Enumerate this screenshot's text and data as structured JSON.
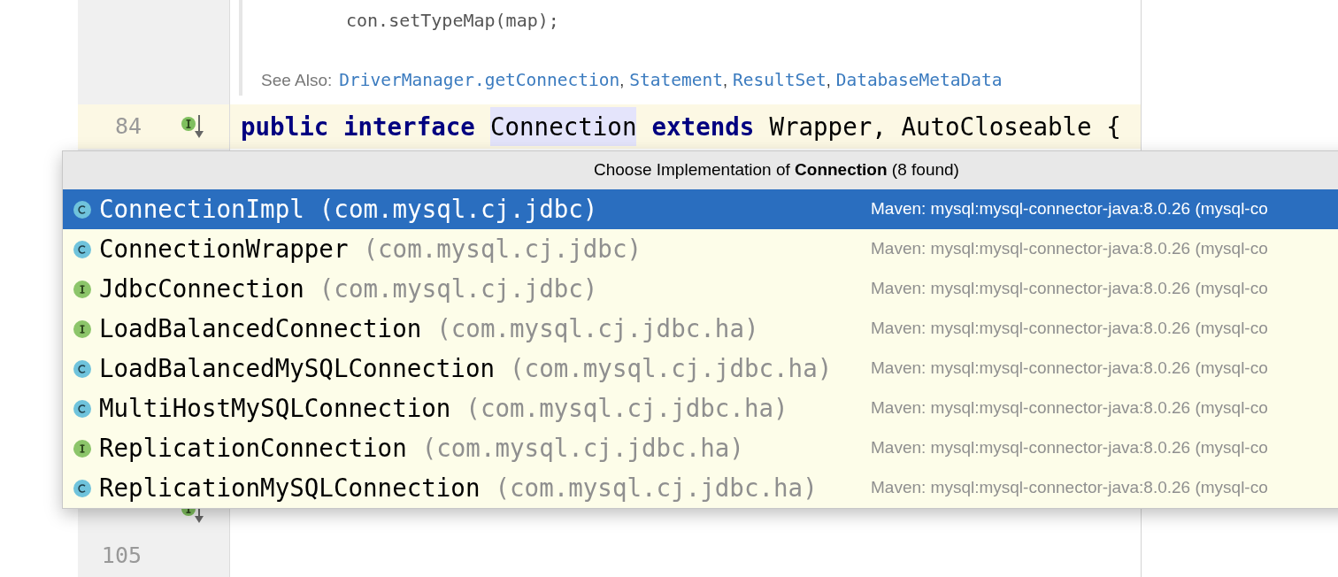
{
  "editor": {
    "doc": {
      "code_line": "con.setTypeMap(map);",
      "see_also_label": "See Also:",
      "separator": ",",
      "see_also_links": [
        "DriverManager.getConnection",
        "Statement",
        "ResultSet",
        "DatabaseMetaData"
      ]
    },
    "lines_top": [
      {
        "number": "84",
        "implementation_marker": true,
        "current": true,
        "tokens": [
          {
            "text": "public interface",
            "kind": "keyword"
          },
          {
            "text": "Connection",
            "kind": "highlighted"
          },
          {
            "text": "extends",
            "kind": "keyword"
          },
          {
            "text": "Wrapper, AutoCloseable {",
            "kind": "plain"
          }
        ]
      }
    ],
    "lines_bottom": [
      {
        "implementation_marker": true,
        "current": false
      },
      {
        "number": "105",
        "implementation_marker": false,
        "current": false
      }
    ]
  },
  "popup": {
    "title": "Choose Implementation of **Connection** (8 found)",
    "items": [
      {
        "kind": "class",
        "name": "ConnectionImpl",
        "package": "(com.mysql.cj.jdbc)",
        "library": "Maven: mysql:mysql-connector-java:8.0.26 (mysql-co",
        "selected": true
      },
      {
        "kind": "class",
        "name": "ConnectionWrapper",
        "package": "(com.mysql.cj.jdbc)",
        "library": "Maven: mysql:mysql-connector-java:8.0.26 (mysql-co",
        "selected": false
      },
      {
        "kind": "interface",
        "name": "JdbcConnection",
        "package": "(com.mysql.cj.jdbc)",
        "library": "Maven: mysql:mysql-connector-java:8.0.26 (mysql-co",
        "selected": false
      },
      {
        "kind": "interface",
        "name": "LoadBalancedConnection",
        "package": "(com.mysql.cj.jdbc.ha)",
        "library": "Maven: mysql:mysql-connector-java:8.0.26 (mysql-co",
        "selected": false
      },
      {
        "kind": "class",
        "name": "LoadBalancedMySQLConnection",
        "package": "(com.mysql.cj.jdbc.ha)",
        "library": "Maven: mysql:mysql-connector-java:8.0.26 (mysql-co",
        "selected": false
      },
      {
        "kind": "class",
        "name": "MultiHostMySQLConnection",
        "package": "(com.mysql.cj.jdbc.ha)",
        "library": "Maven: mysql:mysql-connector-java:8.0.26 (mysql-co",
        "selected": false
      },
      {
        "kind": "interface",
        "name": "ReplicationConnection",
        "package": "(com.mysql.cj.jdbc.ha)",
        "library": "Maven: mysql:mysql-connector-java:8.0.26 (mysql-co",
        "selected": false
      },
      {
        "kind": "class",
        "name": "ReplicationMySQLConnection",
        "package": "(com.mysql.cj.jdbc.ha)",
        "library": "Maven: mysql:mysql-connector-java:8.0.26 (mysql-co",
        "selected": false
      }
    ]
  }
}
